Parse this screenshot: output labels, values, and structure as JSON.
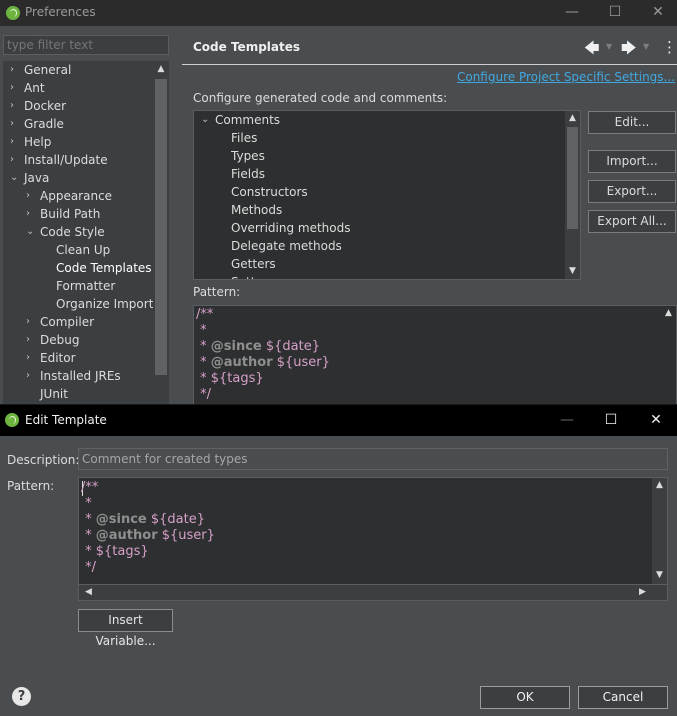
{
  "preferences": {
    "title": "Preferences",
    "filter_placeholder": "type filter text",
    "controls": {
      "minimize": "—",
      "maximize": "☐",
      "close": "✕"
    },
    "tree": [
      {
        "label": "General",
        "twisty": "›"
      },
      {
        "label": "Ant",
        "twisty": "›"
      },
      {
        "label": "Docker",
        "twisty": "›"
      },
      {
        "label": "Gradle",
        "twisty": "›"
      },
      {
        "label": "Help",
        "twisty": "›"
      },
      {
        "label": "Install/Update",
        "twisty": "›"
      },
      {
        "label": "Java",
        "twisty": "⌄"
      },
      {
        "label": "Appearance",
        "twisty": "›"
      },
      {
        "label": "Build Path",
        "twisty": "›"
      },
      {
        "label": "Code Style",
        "twisty": "⌄"
      },
      {
        "label": "Clean Up",
        "twisty": ""
      },
      {
        "label": "Code Templates",
        "twisty": ""
      },
      {
        "label": "Formatter",
        "twisty": ""
      },
      {
        "label": "Organize Imports",
        "twisty": ""
      },
      {
        "label": "Compiler",
        "twisty": "›"
      },
      {
        "label": "Debug",
        "twisty": "›"
      },
      {
        "label": "Editor",
        "twisty": "›"
      },
      {
        "label": "Installed JREs",
        "twisty": "›"
      },
      {
        "label": "JUnit",
        "twisty": ""
      }
    ],
    "page": {
      "title": "Code Templates",
      "back": "🡄",
      "forward": "🡆",
      "dropdown": "▼",
      "menu": "⋮",
      "config_link": "Configure Project Specific Settings...",
      "configure_label": "Configure generated code and comments:",
      "templates": [
        {
          "label": "Comments",
          "twisty": "⌄"
        },
        {
          "label": "Files",
          "twisty": ""
        },
        {
          "label": "Types",
          "twisty": ""
        },
        {
          "label": "Fields",
          "twisty": ""
        },
        {
          "label": "Constructors",
          "twisty": ""
        },
        {
          "label": "Methods",
          "twisty": ""
        },
        {
          "label": "Overriding methods",
          "twisty": ""
        },
        {
          "label": "Delegate methods",
          "twisty": ""
        },
        {
          "label": "Getters",
          "twisty": ""
        },
        {
          "label": "Setters",
          "twisty": ""
        }
      ],
      "buttons": {
        "edit": "Edit...",
        "import": "Import...",
        "export": "Export...",
        "export_all": "Export All..."
      },
      "pattern_label": "Pattern:",
      "pattern_lines": [
        {
          "text": "/**",
          "tag": "",
          "rest": ""
        },
        {
          "text": " *",
          "tag": "",
          "rest": ""
        },
        {
          "text": " * ",
          "tag": "@since",
          "rest": " ${date}"
        },
        {
          "text": " * ",
          "tag": "@author",
          "rest": " ${user}"
        },
        {
          "text": " * ${tags}",
          "tag": "",
          "rest": ""
        },
        {
          "text": " */",
          "tag": "",
          "rest": ""
        }
      ]
    }
  },
  "dialog": {
    "title": "Edit Template",
    "controls": {
      "minimize": "—",
      "maximize": "☐",
      "close": "✕"
    },
    "description_label": "Description:",
    "description_value": "Comment for created types",
    "pattern_label": "Pattern:",
    "pattern_lines": [
      {
        "text": "/**",
        "tag": "",
        "rest": ""
      },
      {
        "text": " *",
        "tag": "",
        "rest": ""
      },
      {
        "text": " * ",
        "tag": "@since",
        "rest": " ${date}"
      },
      {
        "text": " * ",
        "tag": "@author",
        "rest": " ${user}"
      },
      {
        "text": " * ${tags}",
        "tag": "",
        "rest": ""
      },
      {
        "text": " */",
        "tag": "",
        "rest": ""
      }
    ],
    "insert_variable": "Insert Variable...",
    "help": "?",
    "ok": "OK",
    "cancel": "Cancel"
  },
  "scroll_arrows": {
    "up": "▲",
    "down": "▼",
    "left": "◀",
    "right": "▶"
  },
  "colors": {
    "link": "#40a8e0",
    "code": "#d6a0c8",
    "tag": "#8f8f8f",
    "brand": "#6db33f"
  }
}
